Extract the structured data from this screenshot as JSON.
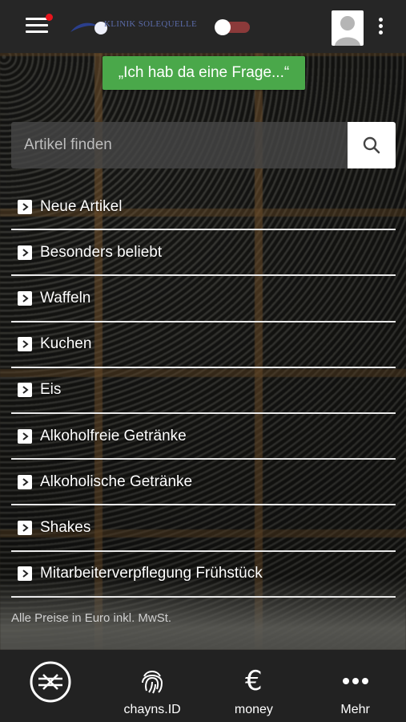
{
  "header": {
    "logo_text": "KLINIK SOLEQUELLE",
    "icons": [
      "hamburger-menu-icon",
      "toggle-icon",
      "avatar-icon",
      "kebab-menu-icon"
    ],
    "notification_color": "#e8141c",
    "toggle_color": "#8b3a3a"
  },
  "question_button": {
    "label": "„Ich hab da eine Frage...“",
    "color": "#4aa84a"
  },
  "search": {
    "placeholder": "Artikel finden",
    "value": "",
    "icon": "search-icon"
  },
  "menu": {
    "items": [
      {
        "label": "Neue Artikel"
      },
      {
        "label": "Besonders beliebt"
      },
      {
        "label": "Waffeln"
      },
      {
        "label": "Kuchen"
      },
      {
        "label": "Eis"
      },
      {
        "label": "Alkoholfreie Getränke"
      },
      {
        "label": "Alkoholische Getränke"
      },
      {
        "label": "Shakes"
      },
      {
        "label": "Mitarbeiterverpflegung Frühstück"
      }
    ]
  },
  "footer_note": "Alle Preise in Euro inkl. MwSt.",
  "bottom_nav": {
    "items": [
      {
        "label": "",
        "icon": "chayns-logo-icon"
      },
      {
        "label": "chayns.ID",
        "icon": "fingerprint-icon"
      },
      {
        "label": "money",
        "icon": "euro-icon"
      },
      {
        "label": "Mehr",
        "icon": "more-dots-icon"
      }
    ]
  }
}
